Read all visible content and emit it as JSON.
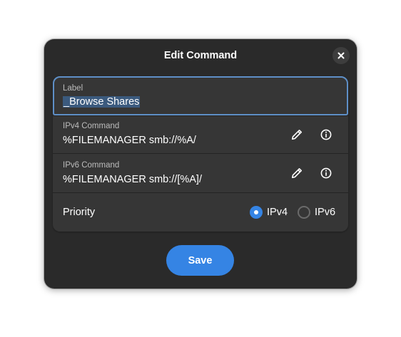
{
  "dialog": {
    "title": "Edit Command",
    "close_icon": "close-icon"
  },
  "fields": {
    "label": {
      "caption": "Label",
      "value": "_Browse Shares"
    },
    "ipv4_command": {
      "caption": "IPv4 Command",
      "value": "%FILEMANAGER smb://%A/"
    },
    "ipv6_command": {
      "caption": "IPv6 Command",
      "value": "%FILEMANAGER smb://[%A]/"
    }
  },
  "priority": {
    "label": "Priority",
    "options": [
      "IPv4",
      "IPv6"
    ],
    "selected": "IPv4"
  },
  "actions": {
    "save_label": "Save"
  },
  "colors": {
    "accent": "#3584e4",
    "focus_border": "#5e8fc7",
    "dialog_bg": "#2a2a2a",
    "list_bg": "#363636"
  }
}
